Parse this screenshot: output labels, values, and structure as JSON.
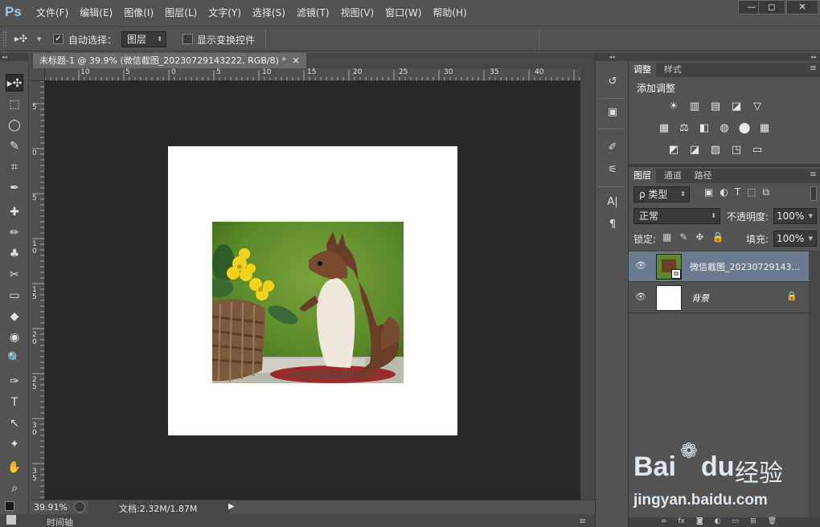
{
  "app": {
    "logo": "Ps"
  },
  "menu": [
    "文件(F)",
    "编辑(E)",
    "图像(I)",
    "图层(L)",
    "文字(Y)",
    "选择(S)",
    "滤镜(T)",
    "视图(V)",
    "窗口(W)",
    "帮助(H)"
  ],
  "window_controls": {
    "minimize": "—",
    "restore": "◻",
    "close": "✕"
  },
  "options": {
    "move_glyph": "▸✣",
    "auto_select_label": "自动选择：",
    "auto_select_checked": true,
    "auto_select_value": "图层",
    "show_transform_label": "显示变换控件",
    "show_transform_checked": false
  },
  "tools": [
    "▸✣",
    "⬚",
    "◯",
    "✎",
    "⌗",
    "✒",
    "✚",
    "✏",
    "♣",
    "✂",
    "▭",
    "◆",
    "◉",
    "🔍",
    "✑",
    "T",
    "↖",
    "✦",
    "✋",
    "⌕"
  ],
  "document": {
    "tab_title": "未标题-1 @ 39.9% (微信截图_20230729143222, RGB/8) *",
    "close": "×"
  },
  "ruler": {
    "h_labels": [
      "10",
      "5",
      "0",
      "5",
      "10",
      "15",
      "20",
      "25",
      "30",
      "35",
      "40"
    ],
    "v_labels": [
      "5",
      "0",
      "5",
      "1 0",
      "1 5",
      "2 0",
      "2 5",
      "3 0",
      "3 5"
    ]
  },
  "status": {
    "zoom": "39.91%",
    "doc_info": "文档:2.32M/1.87M",
    "arrow": "▶"
  },
  "timeline": {
    "label": "时间轴"
  },
  "adjust_panel": {
    "tabs": [
      "调整",
      "样式"
    ],
    "title": "添加调整",
    "row1": [
      "☀",
      "▥",
      "▤",
      "◪",
      "▽"
    ],
    "row2": [
      "▦",
      "⚖",
      "◧",
      "◍",
      "⬤",
      "▦"
    ],
    "row3": [
      "◩",
      "◪",
      "▨",
      "◳",
      "▭"
    ]
  },
  "layers_panel": {
    "tabs": [
      "图层",
      "通道",
      "路径"
    ],
    "filter_label": "ρ 类型",
    "blend_mode": "正常",
    "opacity_label": "不透明度:",
    "opacity_value": "100%",
    "lock_label": "锁定:",
    "fill_label": "填充:",
    "fill_value": "100%",
    "layers": [
      {
        "name": "微信截图_20230729143...",
        "visible": true,
        "selected": true
      },
      {
        "name": "背景",
        "visible": true,
        "selected": false,
        "locked": true
      }
    ]
  },
  "watermark": {
    "brand": "Bai",
    "brand2": "du",
    "product": "经验",
    "url": "jingyan.baidu.com"
  }
}
